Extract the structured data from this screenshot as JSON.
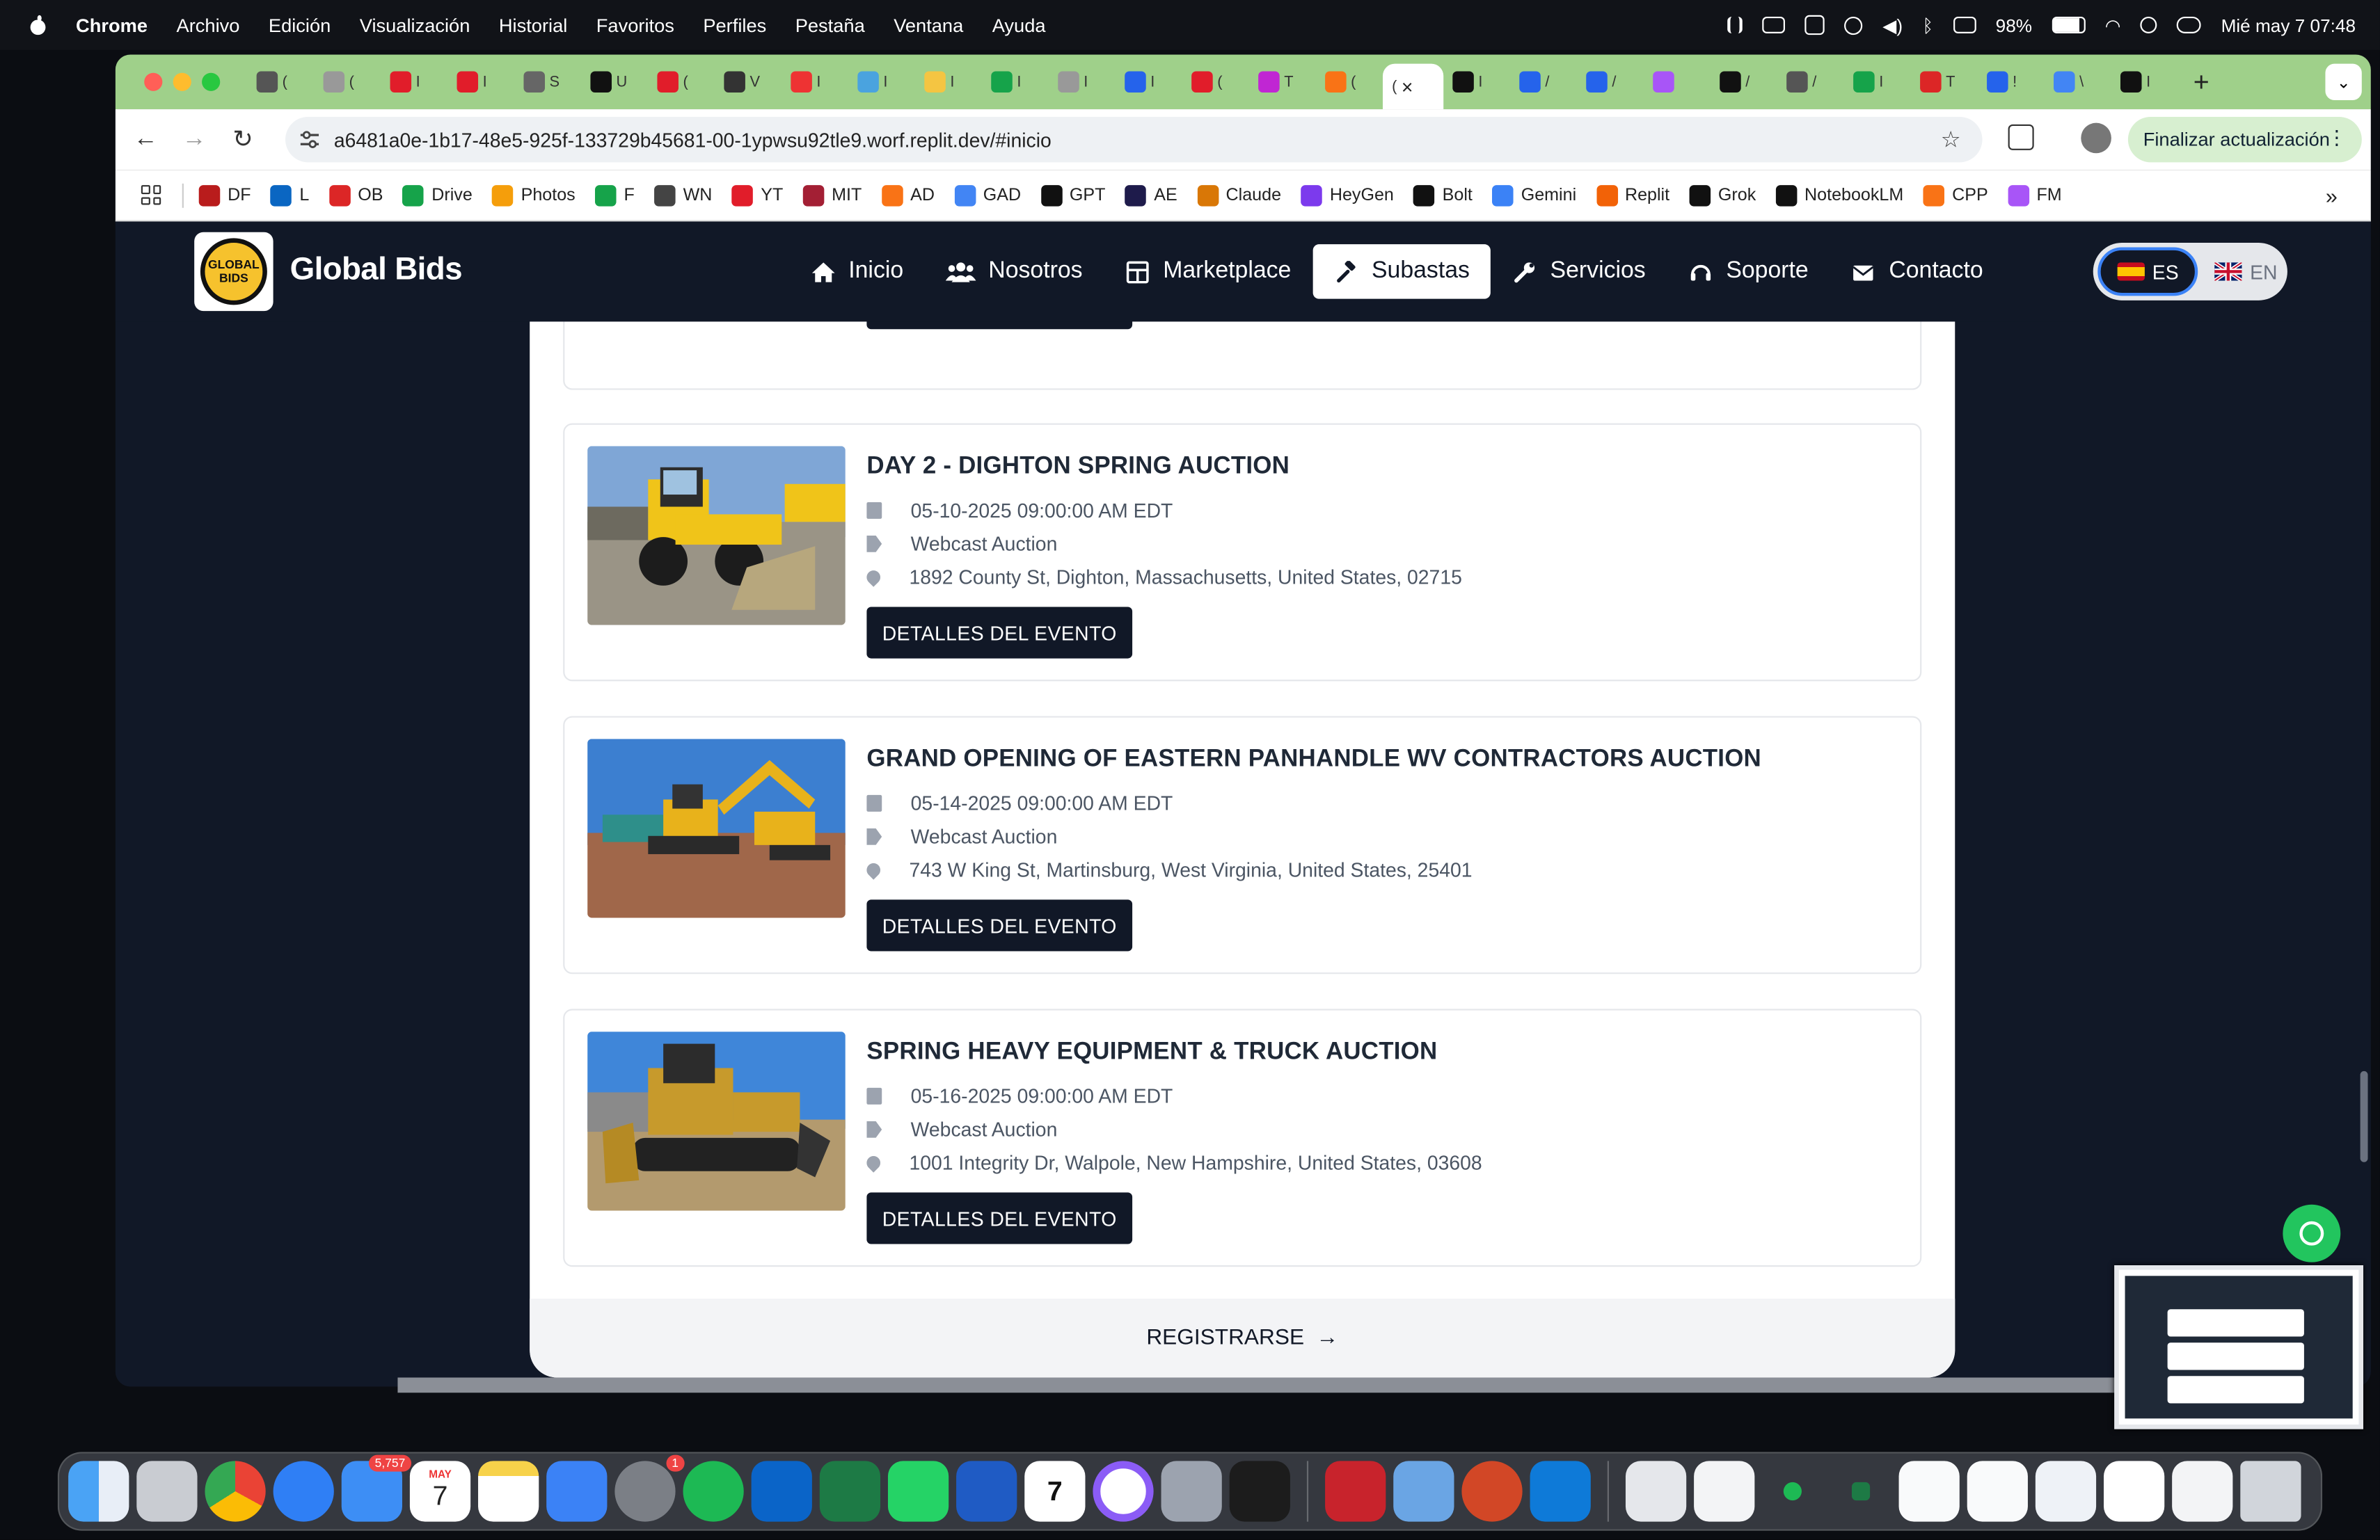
{
  "menubar": {
    "app": "Chrome",
    "items": [
      "Archivo",
      "Edición",
      "Visualización",
      "Historial",
      "Favoritos",
      "Perfiles",
      "Pestaña",
      "Ventana",
      "Ayuda"
    ],
    "battery": "98%",
    "datetime": "Mié may 7  07:48"
  },
  "browser": {
    "tabs": [
      {
        "label": "(",
        "color": "#555"
      },
      {
        "label": "(",
        "color": "#999"
      },
      {
        "label": "I",
        "color": "#e11d2a"
      },
      {
        "label": "I",
        "color": "#e11d2a"
      },
      {
        "label": "S",
        "color": "#666"
      },
      {
        "label": "U",
        "color": "#111"
      },
      {
        "label": "(",
        "color": "#e11d2a"
      },
      {
        "label": "V",
        "color": "#333"
      },
      {
        "label": "I",
        "color": "#e33"
      },
      {
        "label": "I",
        "color": "#4aa3df"
      },
      {
        "label": "I",
        "color": "#f4c542"
      },
      {
        "label": "I",
        "color": "#16a34a"
      },
      {
        "label": "I",
        "color": "#999"
      },
      {
        "label": "I",
        "color": "#2563eb"
      },
      {
        "label": "(",
        "color": "#e11d2a"
      },
      {
        "label": "T",
        "color": "#c026d3"
      },
      {
        "label": "(",
        "color": "#f97316"
      }
    ],
    "active_tab": {
      "label": "(",
      "close": "×"
    },
    "tabs_after": [
      {
        "label": "I",
        "color": "#111"
      },
      {
        "label": "/",
        "color": "#2563eb"
      },
      {
        "label": "/",
        "color": "#2563eb"
      },
      {
        "label": "",
        "color": "#a855f7"
      },
      {
        "label": "/",
        "color": "#111"
      },
      {
        "label": "/",
        "color": "#555"
      },
      {
        "label": "I",
        "color": "#16a34a"
      },
      {
        "label": "T",
        "color": "#dc2626"
      },
      {
        "label": "!",
        "color": "#2563eb"
      },
      {
        "label": "\\",
        "color": "#4285f4"
      },
      {
        "label": "I",
        "color": "#111"
      }
    ],
    "url": "a6481a0e-1b17-48e5-925f-133729b45681-00-1ypwsu92tle9.worf.replit.dev/#inicio",
    "update_button": "Finalizar actualización",
    "bookmarks": [
      {
        "label": "DF",
        "color": "#b91c1c"
      },
      {
        "label": "L",
        "color": "#0a66c2"
      },
      {
        "label": "OB",
        "color": "#dc2626"
      },
      {
        "label": "Drive",
        "color": "#16a34a"
      },
      {
        "label": "Photos",
        "color": "#f59e0b"
      },
      {
        "label": "F",
        "color": "#16a34a"
      },
      {
        "label": "WN",
        "color": "#444"
      },
      {
        "label": "YT",
        "color": "#e11d2a"
      },
      {
        "label": "MIT",
        "color": "#a31f34"
      },
      {
        "label": "AD",
        "color": "#f97316"
      },
      {
        "label": "GAD",
        "color": "#4285f4"
      },
      {
        "label": "GPT",
        "color": "#111"
      },
      {
        "label": "AE",
        "color": "#1e1b4b"
      },
      {
        "label": "Claude",
        "color": "#d97706"
      },
      {
        "label": "HeyGen",
        "color": "#7c3aed"
      },
      {
        "label": "Bolt",
        "color": "#111"
      },
      {
        "label": "Gemini",
        "color": "#3b82f6"
      },
      {
        "label": "Replit",
        "color": "#f26207"
      },
      {
        "label": "Grok",
        "color": "#111"
      },
      {
        "label": "NotebookLM",
        "color": "#111"
      },
      {
        "label": "CPP",
        "color": "#f97316"
      },
      {
        "label": "FM",
        "color": "#a855f7"
      }
    ]
  },
  "site": {
    "brand": "Global Bids",
    "logo_text": "GLOBAL BIDS",
    "nav": [
      {
        "label": "Inicio",
        "icon": "home-icon"
      },
      {
        "label": "Nosotros",
        "icon": "users-icon"
      },
      {
        "label": "Marketplace",
        "icon": "grid-icon"
      },
      {
        "label": "Subastas",
        "icon": "gavel-icon",
        "active": true
      },
      {
        "label": "Servicios",
        "icon": "wrench-icon"
      },
      {
        "label": "Soporte",
        "icon": "headset-icon"
      },
      {
        "label": "Contacto",
        "icon": "envelope-icon"
      }
    ],
    "lang": {
      "es": "ES",
      "en": "EN"
    }
  },
  "events": {
    "button_label": "DETALLES DEL EVENTO",
    "items": [
      {
        "title": "DAY 2 - DIGHTON SPRING AUCTION",
        "date": "05-10-2025 09:00:00 AM EDT",
        "type": "Webcast Auction",
        "address": "1892 County St, Dighton, Massachusetts, United States, 02715"
      },
      {
        "title": "GRAND OPENING OF EASTERN PANHANDLE WV CONTRACTORS AUCTION",
        "date": "05-14-2025 09:00:00 AM EDT",
        "type": "Webcast Auction",
        "address": "743 W King St, Martinsburg, West Virginia, United States, 25401"
      },
      {
        "title": "SPRING HEAVY EQUIPMENT & TRUCK AUCTION",
        "date": "05-16-2025 09:00:00 AM EDT",
        "type": "Webcast Auction",
        "address": "1001 Integrity Dr, Walpole, New Hampshire, United States, 03608"
      }
    ],
    "register": "REGISTRARSE"
  },
  "dock": {
    "mail_badge": "5,757",
    "calendar_month": "MAY",
    "calendar_day": "7",
    "settings_badge": "1",
    "notes_day": "7"
  }
}
